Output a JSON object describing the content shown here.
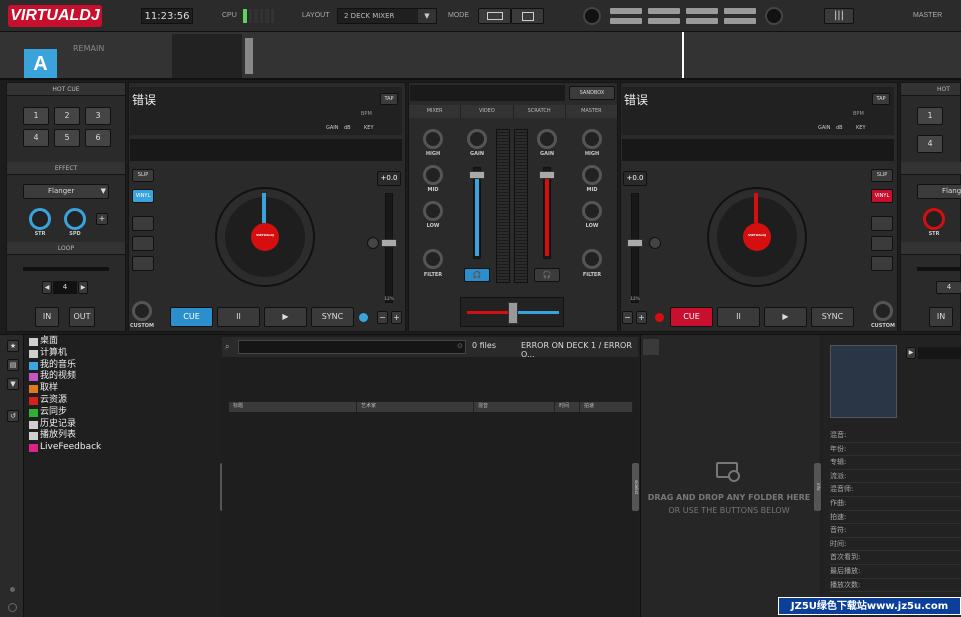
{
  "app": {
    "logo": "VIRTUALDJ",
    "clock": "11:23:56",
    "cpu_label": "CPU",
    "layout_label": "LAYOUT",
    "layout_value": "2 DECK MIXER",
    "mode_label": "MODE",
    "master_label": "MASTER"
  },
  "waveform": {
    "deck_letter": "A",
    "remain_label": "REMAIN"
  },
  "left": {
    "hotcue_label": "HOT CUE",
    "pads": [
      "1",
      "2",
      "3",
      "4",
      "5",
      "6"
    ],
    "effect_label": "EFFECT",
    "effect_value": "Flanger",
    "knob1": "STR",
    "knob2": "SPD",
    "add": "+",
    "loop_label": "LOOP",
    "loop_value": "4",
    "loop_in": "IN",
    "loop_out": "OUT"
  },
  "deck1": {
    "title": "错误",
    "tap": "TAP",
    "bpm": "BPM",
    "gain": "GAIN",
    "db": "dB",
    "key": "KEY",
    "slip": "SLIP",
    "vinyl": "VINYL",
    "custom": "CUSTOM",
    "pitch": "+0.0",
    "pitch_bottom": "12%",
    "platter": "VIRTUALDJ",
    "cue": "CUE",
    "play_pause": "II",
    "play": "▶",
    "sync": "SYNC",
    "minus": "−",
    "plus": "+"
  },
  "deck2": {
    "title": "错误",
    "tap": "TAP",
    "bpm": "BPM",
    "gain": "GAIN",
    "db": "dB",
    "key": "KEY",
    "slip": "SLIP",
    "vinyl": "VINYL",
    "custom": "CUSTOM",
    "pitch": "+0.0",
    "pitch_bottom": "12%",
    "platter": "VIRTUALDJ",
    "cue": "CUE",
    "play_pause": "II",
    "play": "▶",
    "sync": "SYNC",
    "minus": "−",
    "plus": "+"
  },
  "mixer": {
    "sandbox": "SANDBOX",
    "tabs": [
      "MIXER",
      "VIDEO",
      "SCRATCH",
      "MASTER"
    ],
    "knobs_left": [
      "HIGH",
      "MID",
      "LOW",
      "FILTER"
    ],
    "knobs_right": [
      "HIGH",
      "MID",
      "LOW",
      "FILTER"
    ],
    "gain": "GAIN"
  },
  "right": {
    "hotcue_label": "HOT",
    "pads": [
      "1",
      "4"
    ],
    "effect_value": "Flange",
    "knob1": "STR",
    "loop_value": "4",
    "loop_in": "IN"
  },
  "browser": {
    "tree": [
      {
        "label": "桌面",
        "color": "#cfcfcf"
      },
      {
        "label": "计算机",
        "color": "#cfcfcf"
      },
      {
        "label": "我的音乐",
        "color": "#3aa7e4"
      },
      {
        "label": "我的视频",
        "color": "#c456c4"
      },
      {
        "label": "取样",
        "color": "#e07a20"
      },
      {
        "label": "云资源",
        "color": "#d81e1e"
      },
      {
        "label": "云同步",
        "color": "#30b030"
      },
      {
        "label": "历史记录",
        "color": "#cfcfcf"
      },
      {
        "label": "播放列表",
        "color": "#cfcfcf"
      },
      {
        "label": "LiveFeedback",
        "color": "#e0208a"
      }
    ],
    "file_count": "0 files",
    "error": "ERROR ON DECK 1 / ERROR O...",
    "columns": [
      "标题",
      "艺术家",
      "混音",
      "时间",
      "拍速"
    ],
    "folders_tab": "folders",
    "sidelist_tab": "sidelist",
    "info_tab": "info",
    "drop_line1": "DRAG AND DROP ANY FOLDER HERE",
    "drop_line2": "OR USE THE BUTTONS BELOW",
    "info_fields": [
      "混音:",
      "年份:",
      "专辑:",
      "流派:",
      "混音师:",
      "作曲:",
      "拍速:",
      "音符:",
      "时间:",
      "首次看到:",
      "最后播放:",
      "播放次数:"
    ]
  },
  "watermark": "JZ5U绿色下载站www.jz5u.com"
}
